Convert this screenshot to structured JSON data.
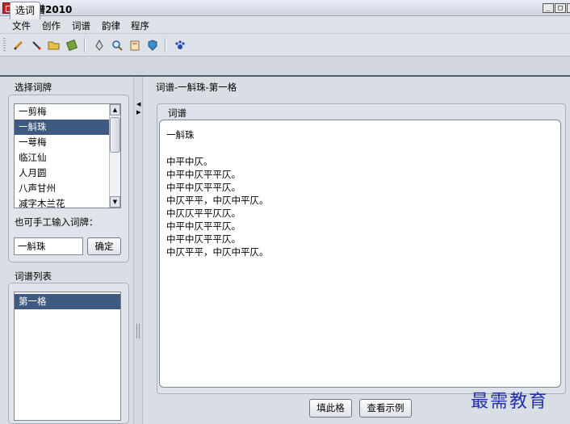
{
  "window": {
    "title": "白香谱2010"
  },
  "menu": [
    "文件",
    "创作",
    "词谱",
    "韵律",
    "程序"
  ],
  "toolbar_icons": [
    "pencil-icon",
    "brush-icon",
    "open-folder-icon",
    "book-icon",
    "pen-nib-icon",
    "magnifier-icon",
    "card-icon",
    "shield-icon",
    "paw-icon"
  ],
  "tab": "选词",
  "left": {
    "select_title": "选择词牌",
    "cipai_items": [
      "一剪梅",
      "一斛珠",
      "一萼梅",
      "临江仙",
      "人月圆",
      "八声甘州",
      "减字木兰花"
    ],
    "selected_index": 1,
    "manual_label": "也可手工输入词牌：",
    "manual_value": "一斛珠",
    "confirm_button": "确定",
    "pu_list_title": "词谱列表",
    "pu_list_items": [
      "第一格"
    ]
  },
  "right": {
    "breadcrumb": "词谱-一斛珠-第一格",
    "group_title": "词谱",
    "lines": [
      "一斛珠",
      "",
      "中平中仄。",
      "中平中仄平平仄。",
      "中平中仄平平仄。",
      "中仄平平，中仄中平仄。",
      "中仄仄平平仄仄。",
      "中平中仄平平仄。",
      "中平中仄平平仄。",
      "中仄平平，中仄中平仄。"
    ],
    "fill_button": "填此格",
    "example_button": "查看示例"
  },
  "watermark": "最需教育"
}
